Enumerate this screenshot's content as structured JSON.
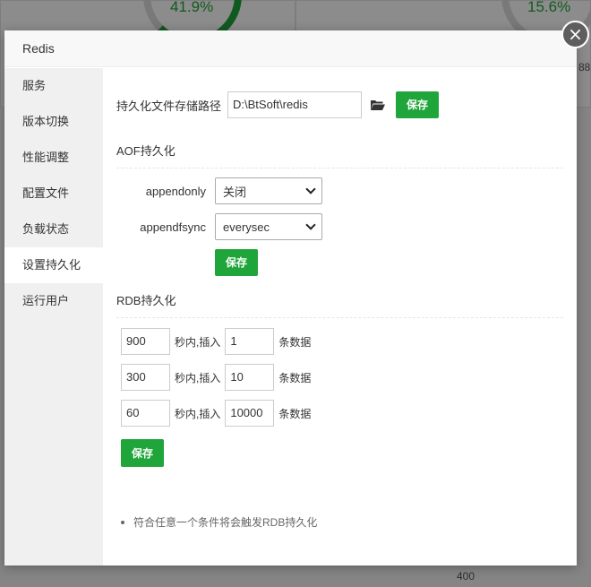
{
  "background": {
    "gauge_left_value": "41.9%",
    "gauge_right_value": "15.6%",
    "edge_text_right": "88",
    "axis_label_bottom": "400"
  },
  "modal": {
    "title": "Redis",
    "close_symbol": "×"
  },
  "sidebar": {
    "items": [
      {
        "label": "服务"
      },
      {
        "label": "版本切换"
      },
      {
        "label": "性能调整"
      },
      {
        "label": "配置文件"
      },
      {
        "label": "负载状态"
      },
      {
        "label": "设置持久化"
      },
      {
        "label": "运行用户"
      }
    ],
    "active_index": 5
  },
  "persistence": {
    "path_label": "持久化文件存储路径",
    "path_value": "D:\\BtSoft\\redis",
    "save_label": "保存",
    "aof": {
      "title": "AOF持久化",
      "appendonly_label": "appendonly",
      "appendonly_value": "关闭",
      "appendfsync_label": "appendfsync",
      "appendfsync_value": "everysec",
      "save_label": "保存"
    },
    "rdb": {
      "title": "RDB持久化",
      "rows": [
        {
          "seconds": "900",
          "middle_text": "秒内,插入",
          "changes": "1",
          "suffix": "条数据"
        },
        {
          "seconds": "300",
          "middle_text": "秒内,插入",
          "changes": "10",
          "suffix": "条数据"
        },
        {
          "seconds": "60",
          "middle_text": "秒内,插入",
          "changes": "10000",
          "suffix": "条数据"
        }
      ],
      "save_label": "保存",
      "note": "符合任意一个条件将会触发RDB持久化"
    }
  },
  "colors": {
    "accent_green": "#20a53a"
  }
}
